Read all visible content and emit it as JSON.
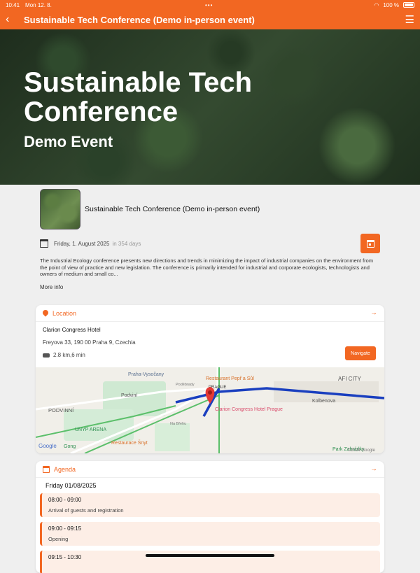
{
  "status": {
    "time": "10:41",
    "date": "Mon 12. 8.",
    "battery": "100 %"
  },
  "topbar": {
    "title": "Sustainable Tech Conference (Demo in-person event)"
  },
  "hero": {
    "title": "Sustainable Tech Conference",
    "subtitle": "Demo Event"
  },
  "event": {
    "title": "Sustainable Tech Conference (Demo in-person event)",
    "date": "Friday, 1. August 2025",
    "countdown": "in 354 days",
    "description": "The Industrial Ecology conference presents new directions and trends in minimizing the impact of industrial companies on the environment from the point of view of practice and new legislation. The conference is primarily intended for industrial and corporate ecologists, technologists and owners of medium and small co...",
    "more": "More info"
  },
  "location": {
    "heading": "Location",
    "venue": "Clarion Congress Hotel",
    "address": "Freyova 33, 190 00 Praha 9, Czechia",
    "distance": "2.8 km,6 min",
    "navigate": "Navigate",
    "map_labels": {
      "a": "Praha-Vysočany",
      "b": "Restaurant Pepř a Sůl",
      "c": "AFI CITY",
      "d": "Podviní",
      "e": "PODVINNÍ",
      "f": "UNYP ARENA",
      "g": "Clarion Congress Hotel Prague",
      "h": "Kolbenova",
      "i": "Restaurace Šnyt",
      "j": "Park Zahrádky",
      "k": "Gong",
      "l": "Google",
      "m": "PRAGUE",
      "n": "©2024 Google",
      "o": "Poděbrady",
      "p": "Na Břehu"
    }
  },
  "agenda": {
    "heading": "Agenda",
    "day": "Friday 01/08/2025",
    "slots": [
      {
        "time": "08:00 - 09:00",
        "name": "Arrival of guests and registration"
      },
      {
        "time": "09:00 - 09:15",
        "name": "Opening"
      },
      {
        "time": "09:15 - 10:30",
        "name": ""
      }
    ]
  },
  "colors": {
    "accent": "#f26722"
  }
}
